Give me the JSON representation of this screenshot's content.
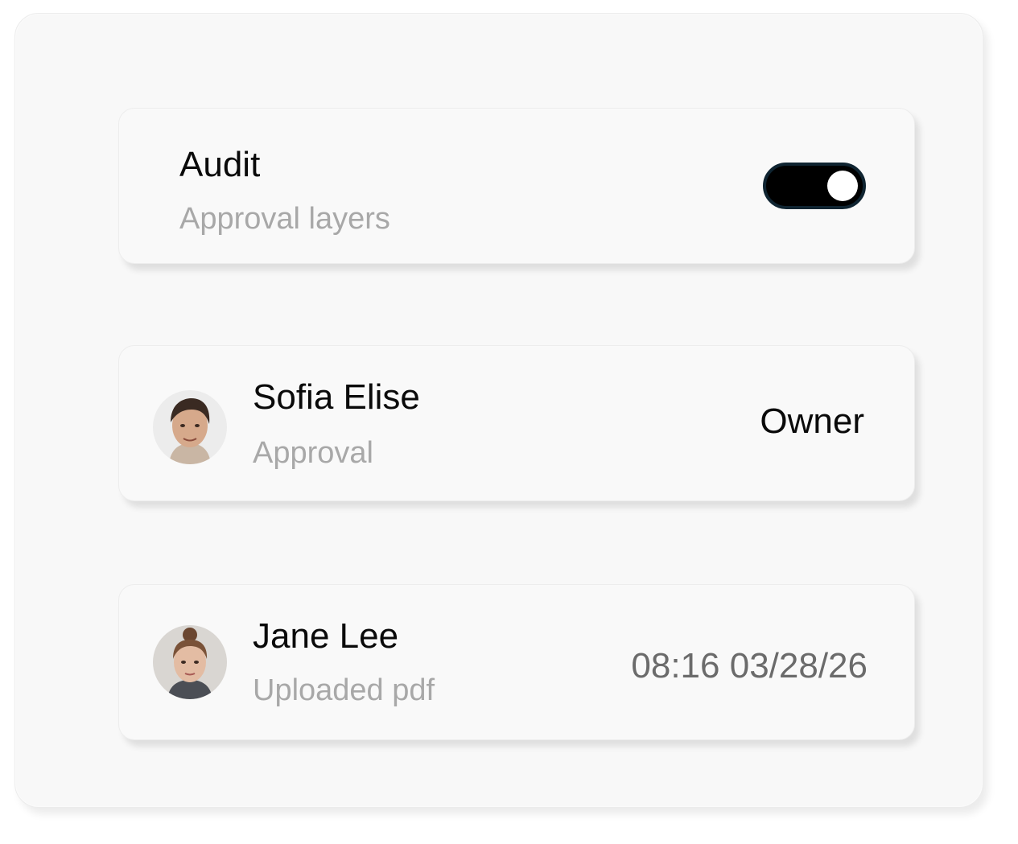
{
  "audit": {
    "title": "Audit",
    "subtitle": "Approval layers",
    "toggle_on": true
  },
  "entries": [
    {
      "name": "Sofia Elise",
      "detail": "Approval",
      "meta": "Owner",
      "avatar": "person-photo"
    },
    {
      "name": "Jane Lee",
      "detail": "Uploaded pdf",
      "meta": "08:16 03/28/26",
      "avatar": "person-photo"
    }
  ],
  "colors": {
    "toggle_track": "#000000",
    "toggle_border": "#0f2431",
    "title": "#0a0a0a",
    "subtitle": "#a8a8a8",
    "timestamp": "#6b6b6b",
    "card_bg": "#f9f9f9"
  }
}
